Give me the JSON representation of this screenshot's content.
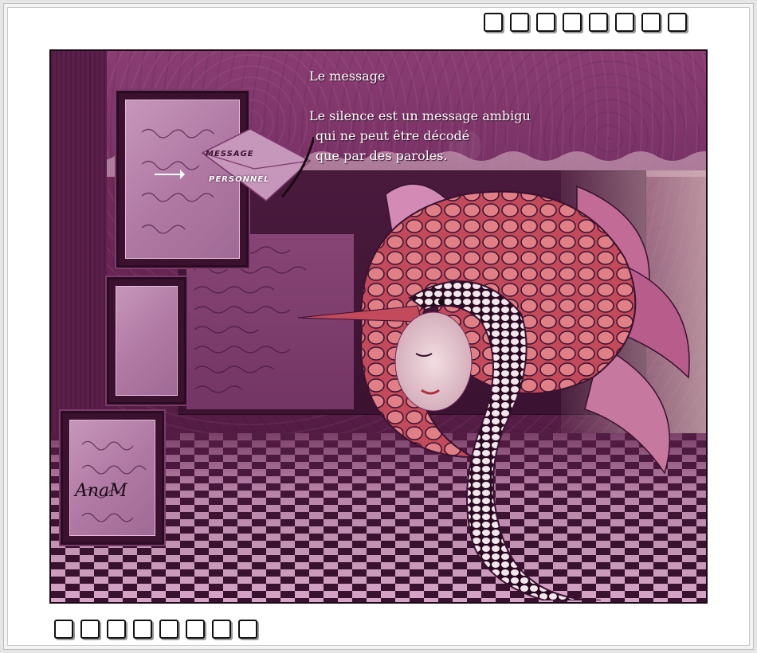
{
  "frame": {
    "top_squares_count": 8,
    "bottom_squares_count": 8
  },
  "message": {
    "title": "Le message",
    "lines": [
      "Le silence est un message ambigu",
      "qui ne peut être décodé",
      "que par des paroles."
    ]
  },
  "envelope": {
    "word1": "MESSAGE",
    "word2": "PERSONNEL"
  },
  "signature": "AnaM",
  "colors": {
    "accent": "#7a3266",
    "dark": "#3a1230",
    "light_pink": "#d9a6c9",
    "text": "#ffffff"
  }
}
